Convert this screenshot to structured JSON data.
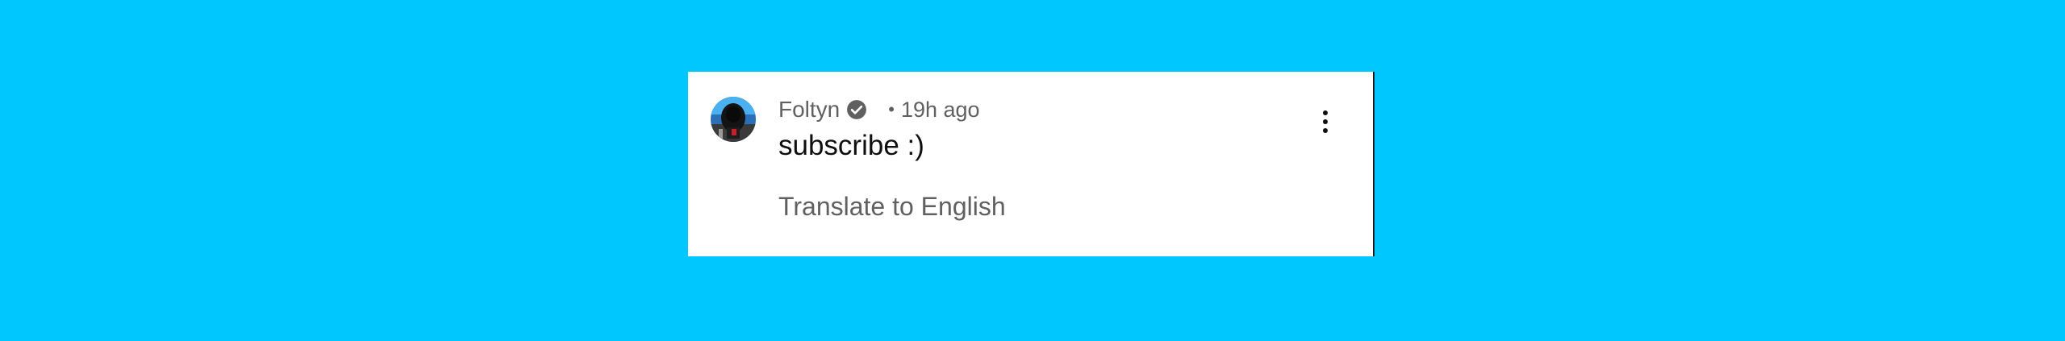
{
  "comment": {
    "author": "Foltyn",
    "separator": "•",
    "timestamp": "19h ago",
    "text": "subscribe :)",
    "translate_label": "Translate to English"
  },
  "icons": {
    "verified": "verified-check-icon",
    "more": "more-vertical-icon",
    "avatar": "user-avatar"
  },
  "colors": {
    "background": "#00c8ff",
    "card": "#ffffff",
    "secondary_text": "#606060",
    "primary_text": "#0f0f0f"
  }
}
